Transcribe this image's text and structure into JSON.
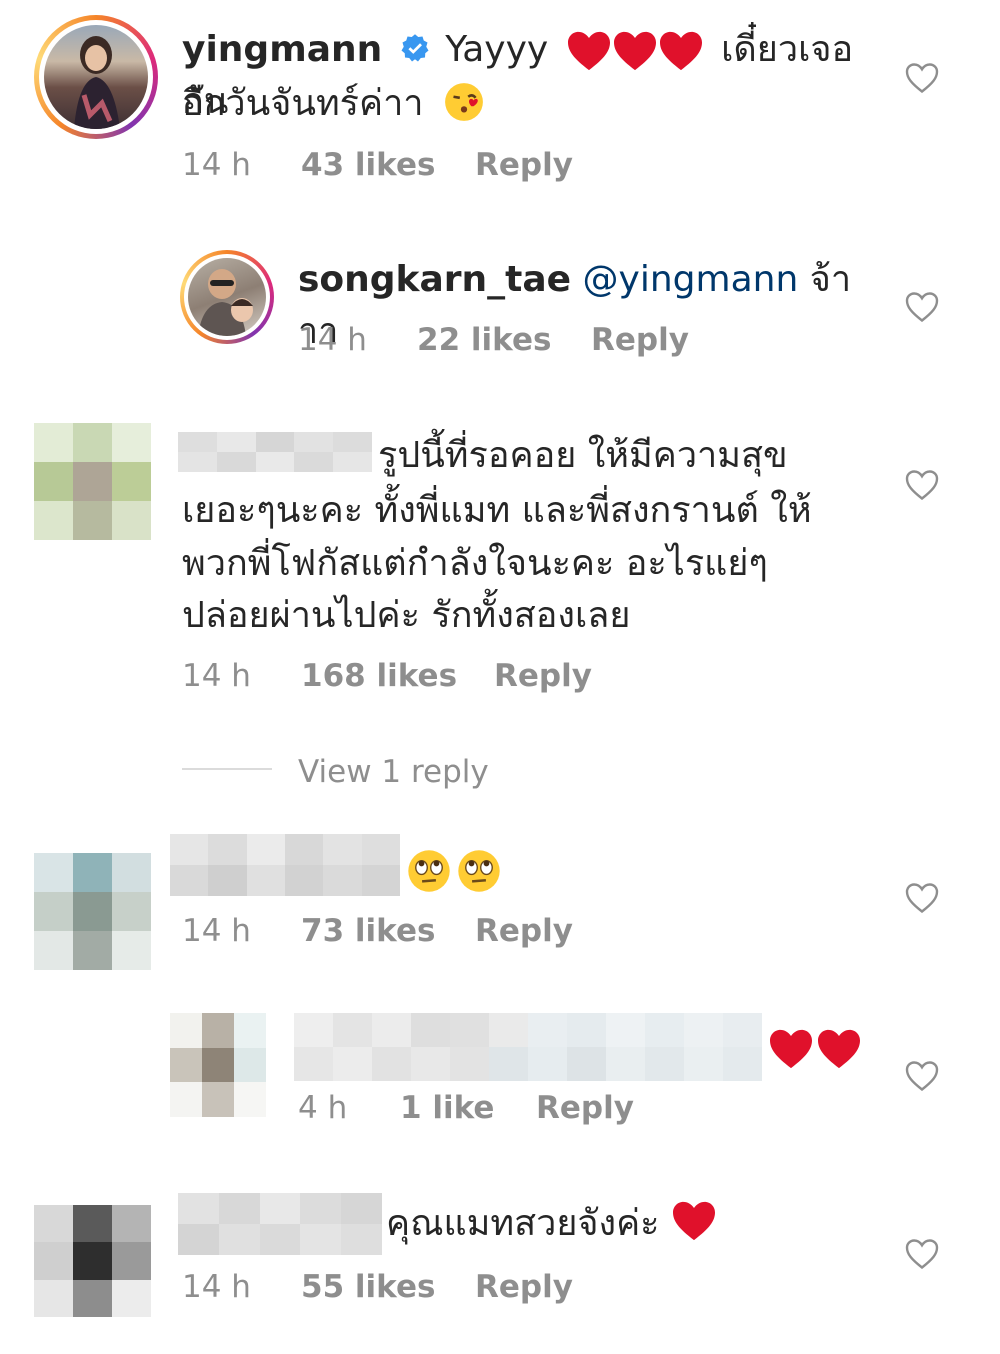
{
  "comments": [
    {
      "username": "yingmann",
      "verified": true,
      "text_line1": "Yayyy",
      "text_line1_after": "เดี๋ยวเจอกัน",
      "text_line2": "อีกวันจันทร์ค่าา",
      "time": "14 h",
      "likes": "43 likes",
      "reply": "Reply"
    },
    {
      "username": "songkarn_tae",
      "mention": "@yingmann",
      "text": "จ้าาา",
      "time": "14 h",
      "likes": "22 likes",
      "reply": "Reply"
    },
    {
      "text_lines": [
        "รูปนี้ที่รอคอย ให้มีความสุข",
        "เยอะๆนะคะ ทั้งพี่แมท และพี่สงกรานต์ ให้",
        "พวกพี่โฟกัสแต่กำลังใจนะคะ อะไรแย่ๆ",
        "ปล่อยผ่านไปค่ะ รักทั้งสองเลย"
      ],
      "time": "14 h",
      "likes": "168 likes",
      "reply": "Reply"
    },
    {
      "time": "14 h",
      "likes": "73 likes",
      "reply": "Reply"
    },
    {
      "time": "4 h",
      "likes": "1 like",
      "reply": "Reply"
    },
    {
      "text": "คุณแมทสวยจังค่ะ",
      "time": "14 h",
      "likes": "55 likes",
      "reply": "Reply"
    }
  ],
  "view_replies": "View 1 reply",
  "colors": {
    "text": "#262626",
    "meta": "#8e8e8e",
    "mention": "#00376b",
    "verified": "#3897f0",
    "heart_red": "#e0112b"
  },
  "icons": [
    "heart-outline-icon",
    "verified-badge-icon",
    "red-heart-emoji",
    "kiss-emoji",
    "eye-roll-emoji"
  ]
}
